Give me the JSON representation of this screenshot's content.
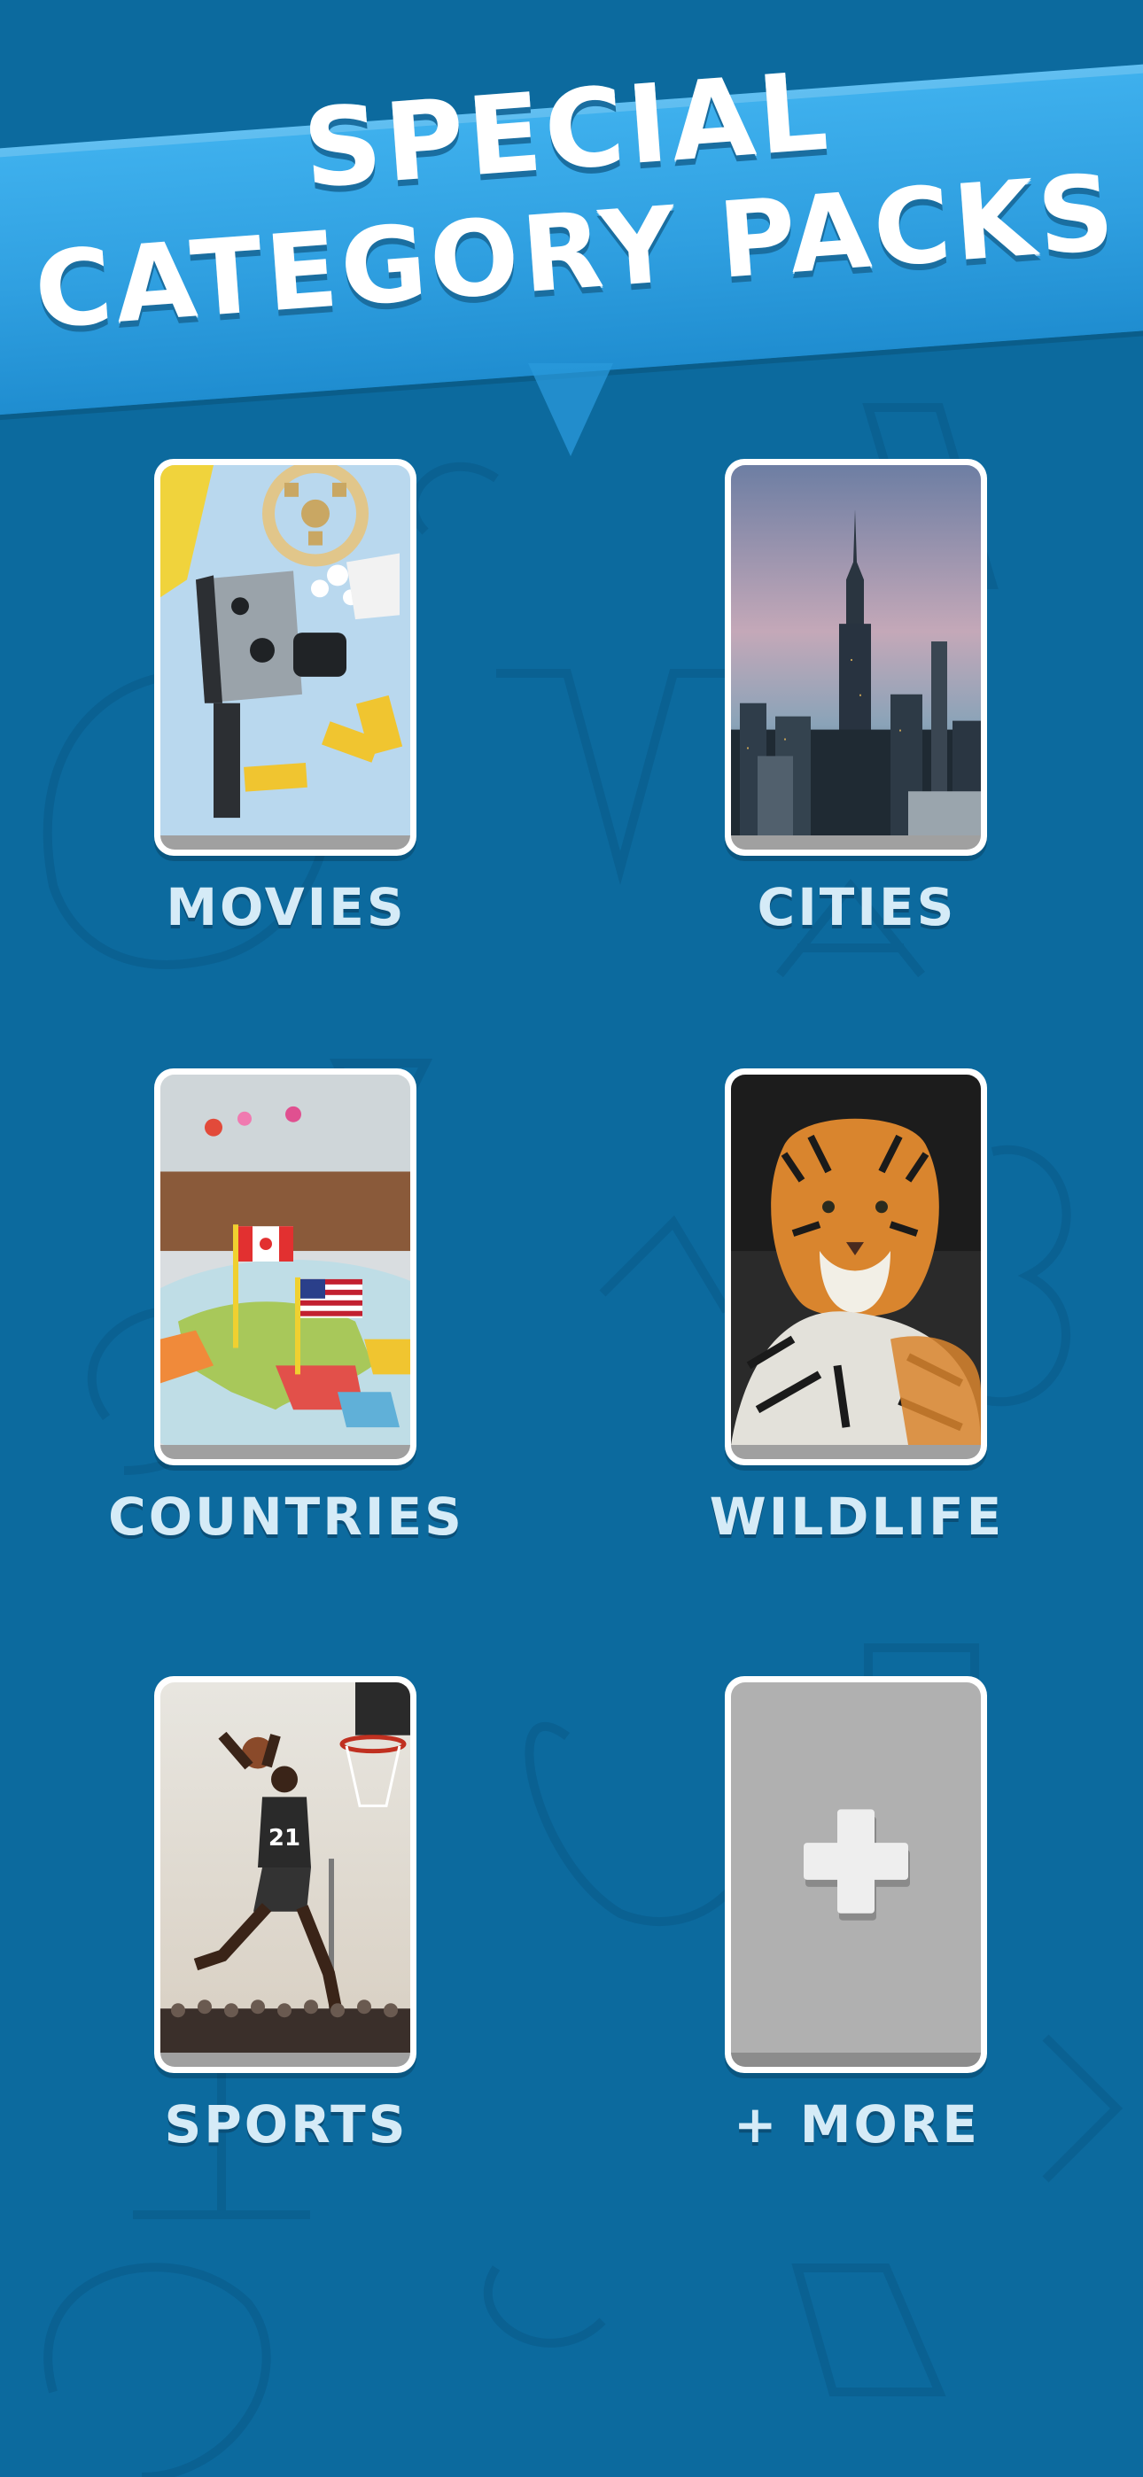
{
  "header": {
    "title_line1": "SPECIAL",
    "title_line2": "CATEGORY PACKS"
  },
  "categories": [
    {
      "label": "MOVIES",
      "image": "movie-camera-popcorn-tickets"
    },
    {
      "label": "CITIES",
      "image": "city-skyline-empire-state"
    },
    {
      "label": "COUNTRIES",
      "image": "map-with-flag-pins"
    },
    {
      "label": "WILDLIFE",
      "image": "tiger"
    },
    {
      "label": "SPORTS",
      "image": "basketball-player-dunk"
    },
    {
      "label": "+ MORE",
      "image": "plus-icon"
    }
  ],
  "colors": {
    "background": "#0c6a9e",
    "banner": "#2f9fe0",
    "label_text": "#d5ebf7",
    "card_border": "#ffffff",
    "more_card": "#b0b0b0"
  }
}
